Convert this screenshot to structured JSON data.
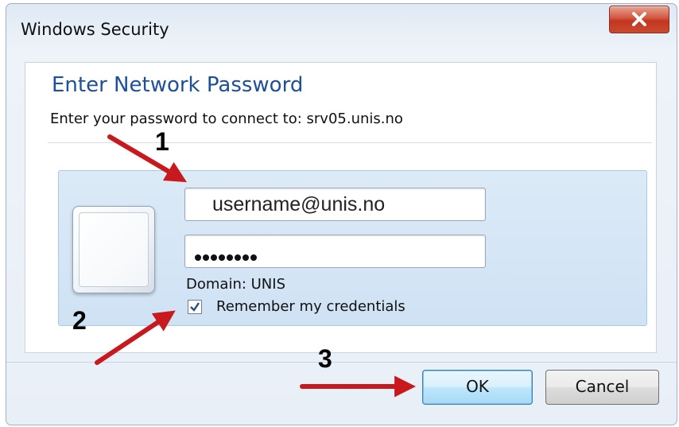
{
  "window": {
    "title": "Windows Security"
  },
  "dialog": {
    "heading": "Enter Network Password",
    "subtext": "Enter your password to connect to: srv05.unis.no"
  },
  "credentials": {
    "username_value": "username@unis.no",
    "password_mask_length": 8,
    "domain_label": "Domain: UNIS",
    "remember_label": "Remember my credentials",
    "remember_checked": true
  },
  "buttons": {
    "ok": "OK",
    "cancel": "Cancel"
  },
  "annotations": {
    "step1": "1",
    "step2": "2",
    "step3": "3",
    "arrow_color": "#c8191e"
  },
  "icons": {
    "close": "close-icon",
    "user_tile": "user-tile-icon",
    "checkmark": "checkmark-icon"
  }
}
